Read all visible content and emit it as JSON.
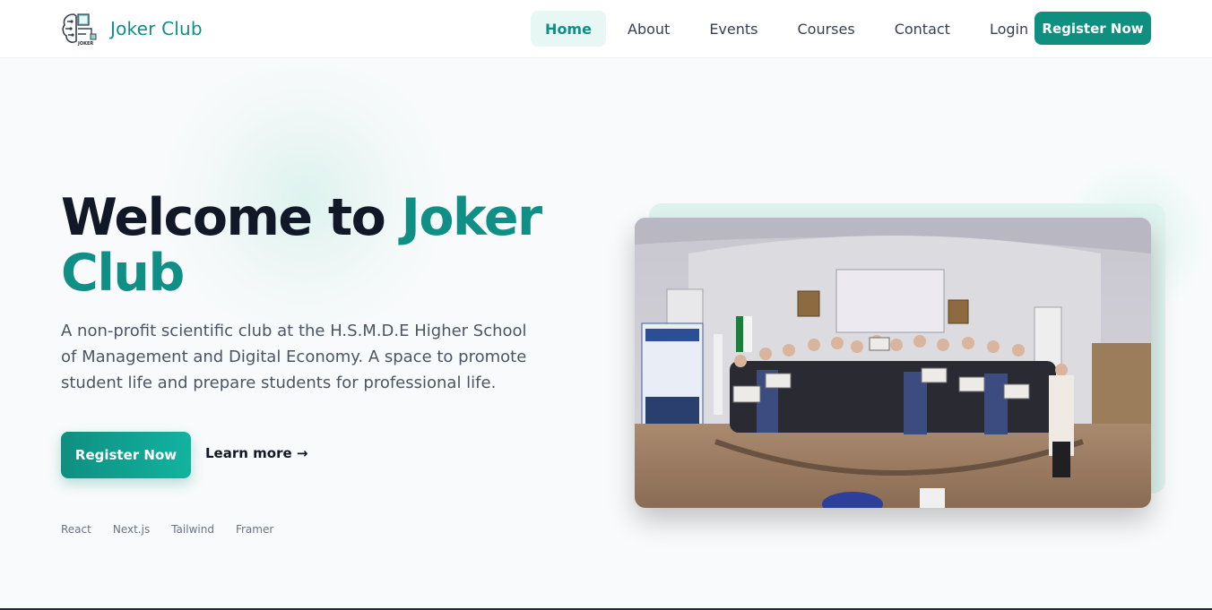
{
  "brand": {
    "name": "Joker Club",
    "logo_icon": "brain-circuit-icon",
    "logo_text": "JOKER"
  },
  "nav": {
    "items": [
      {
        "label": "Home",
        "active": true
      },
      {
        "label": "About",
        "active": false
      },
      {
        "label": "Events",
        "active": false
      },
      {
        "label": "Courses",
        "active": false
      },
      {
        "label": "Contact",
        "active": false
      },
      {
        "label": "Login",
        "active": false
      }
    ],
    "register_label": "Register Now"
  },
  "hero": {
    "title_part1": "Welcome to ",
    "title_accent1": "Joker",
    "title_accent2": "Club",
    "description": "A non-profit scientific club at the H.S.M.D.E Higher School of Management and Digital Economy. A space to promote student life and prepare students for professional life.",
    "register_label": "Register Now",
    "learn_more_label": "Learn more →",
    "tech": [
      "React",
      "Next.js",
      "Tailwind",
      "Framer"
    ]
  },
  "colors": {
    "accent": "#0f8f86",
    "button": "#0f8f80",
    "nav_active_bg": "#e7f7f4",
    "heading": "#111827"
  }
}
